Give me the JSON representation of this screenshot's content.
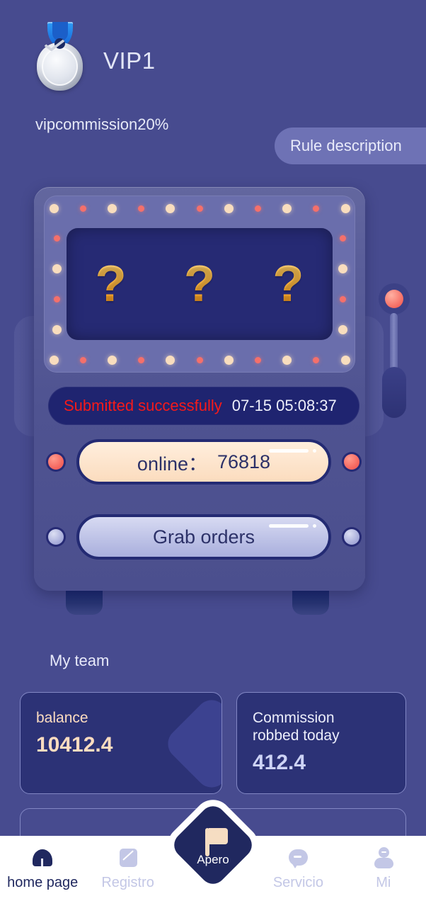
{
  "theme": {
    "background": "#474b8f",
    "machine_body": "#4f5391",
    "screen": "#262a74",
    "accent_red": "#f51a1a",
    "accent_cream": "#fcdcc0",
    "accent_lavender": "#c3c7e6",
    "navy_dark": "#20285f"
  },
  "header": {
    "medal_icon": "vip-medal-icon",
    "vip_level": "VIP1",
    "vip_commission": "vipcommission20%",
    "rule_button": "Rule description"
  },
  "machine": {
    "reels": [
      "?",
      "?",
      "?"
    ],
    "status_message": "Submitted successfully",
    "status_time": "07-15 05:08:37",
    "online_label": "online：",
    "online_count": "76818",
    "grab_button": "Grab orders",
    "lever_icon": "slot-lever-icon"
  },
  "team": {
    "section_title": "My team",
    "cards": [
      {
        "title": "balance",
        "value": "10412.4"
      },
      {
        "title": "Commission robbed today",
        "title_line1": "Commission",
        "title_line2": "robbed today",
        "value": "412.4"
      }
    ]
  },
  "bottom_nav": {
    "items": [
      {
        "label": "home page",
        "icon": "home-icon",
        "active": true
      },
      {
        "label": "Registro",
        "icon": "document-icon",
        "active": false
      },
      {
        "label": "Servicio",
        "icon": "chat-bubble-icon",
        "active": false
      },
      {
        "label": "Mi",
        "icon": "user-icon",
        "active": false
      }
    ],
    "center": {
      "label": "Apero",
      "icon": "flag-icon"
    }
  }
}
